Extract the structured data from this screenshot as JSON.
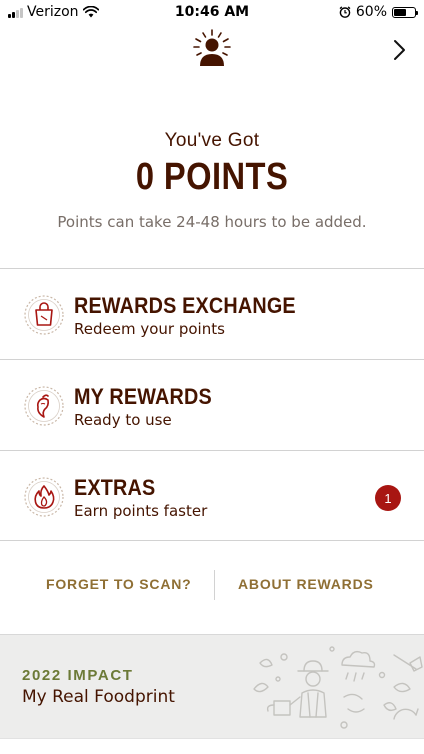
{
  "status_bar": {
    "carrier": "Verizon",
    "time": "10:46 AM",
    "battery_percent": "60%",
    "battery_level": 0.6,
    "icons": [
      "signal-icon",
      "wifi-icon",
      "alarm-icon",
      "battery-icon"
    ]
  },
  "header": {
    "avatar_icon": "profile-sun-icon",
    "forward_icon": "chevron-right-icon"
  },
  "points": {
    "heading": "You've Got",
    "value": "0 POINTS",
    "note": "Points can take 24-48 hours to be added."
  },
  "menu": {
    "items": [
      {
        "title": "REWARDS EXCHANGE",
        "subtitle": "Redeem your points",
        "icon": "shopping-bag-icon"
      },
      {
        "title": "MY REWARDS",
        "subtitle": "Ready to use",
        "icon": "pepper-icon"
      },
      {
        "title": "EXTRAS",
        "subtitle": "Earn points faster",
        "icon": "flame-icon",
        "badge": "1"
      }
    ]
  },
  "links": {
    "forget_to_scan": "FORGET TO SCAN?",
    "about_rewards": "ABOUT REWARDS"
  },
  "impact": {
    "label": "2022 IMPACT",
    "title": "My Real Foodprint",
    "illustration_icon": "farmer-illustration-icon"
  },
  "colors": {
    "brand_brown": "#451400",
    "gold_link": "#8f6f34",
    "impact_green": "#6c7a37",
    "badge_red": "#a81612",
    "icon_red": "#a81612"
  }
}
